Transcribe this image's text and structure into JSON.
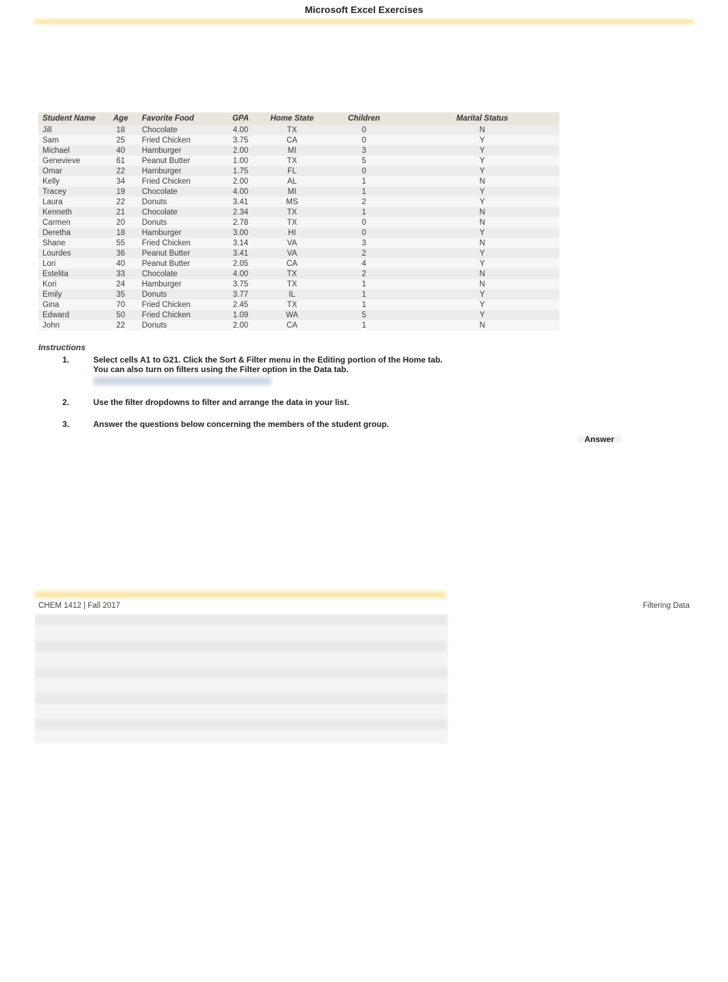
{
  "page_title": "Microsoft Excel Exercises",
  "table": {
    "headers": {
      "name": "Student Name",
      "age": "Age",
      "food": "Favorite Food",
      "gpa": "GPA",
      "state": "Home State",
      "children": "Children",
      "marital": "Marital Status"
    },
    "rows": [
      {
        "name": "Jill",
        "age": "18",
        "food": "Chocolate",
        "gpa": "4.00",
        "state": "TX",
        "children": "0",
        "marital": "N"
      },
      {
        "name": "Sam",
        "age": "25",
        "food": "Fried Chicken",
        "gpa": "3.75",
        "state": "CA",
        "children": "0",
        "marital": "Y"
      },
      {
        "name": "Michael",
        "age": "40",
        "food": "Hamburger",
        "gpa": "2.00",
        "state": "MI",
        "children": "3",
        "marital": "Y"
      },
      {
        "name": "Genevieve",
        "age": "61",
        "food": "Peanut Butter",
        "gpa": "1.00",
        "state": "TX",
        "children": "5",
        "marital": "Y"
      },
      {
        "name": "Omar",
        "age": "22",
        "food": "Hamburger",
        "gpa": "1.75",
        "state": "FL",
        "children": "0",
        "marital": "Y"
      },
      {
        "name": "Kelly",
        "age": "34",
        "food": "Fried Chicken",
        "gpa": "2.00",
        "state": "AL",
        "children": "1",
        "marital": "N"
      },
      {
        "name": "Tracey",
        "age": "19",
        "food": "Chocolate",
        "gpa": "4.00",
        "state": "MI",
        "children": "1",
        "marital": "Y"
      },
      {
        "name": "Laura",
        "age": "22",
        "food": "Donuts",
        "gpa": "3.41",
        "state": "MS",
        "children": "2",
        "marital": "Y"
      },
      {
        "name": "Kenneth",
        "age": "21",
        "food": "Chocolate",
        "gpa": "2.34",
        "state": "TX",
        "children": "1",
        "marital": "N"
      },
      {
        "name": "Carmen",
        "age": "20",
        "food": "Donuts",
        "gpa": "2.78",
        "state": "TX",
        "children": "0",
        "marital": "N"
      },
      {
        "name": "Deretha",
        "age": "18",
        "food": "Hamburger",
        "gpa": "3.00",
        "state": "HI",
        "children": "0",
        "marital": "Y"
      },
      {
        "name": "Shane",
        "age": "55",
        "food": "Fried Chicken",
        "gpa": "3.14",
        "state": "VA",
        "children": "3",
        "marital": "N"
      },
      {
        "name": "Lourdes",
        "age": "36",
        "food": "Peanut Butter",
        "gpa": "3.41",
        "state": "VA",
        "children": "2",
        "marital": "Y"
      },
      {
        "name": "Lori",
        "age": "40",
        "food": "Peanut Butter",
        "gpa": "2.05",
        "state": "CA",
        "children": "4",
        "marital": "Y"
      },
      {
        "name": "Estelita",
        "age": "33",
        "food": "Chocolate",
        "gpa": "4.00",
        "state": "TX",
        "children": "2",
        "marital": "N"
      },
      {
        "name": "Kori",
        "age": "24",
        "food": "Hamburger",
        "gpa": "3.75",
        "state": "TX",
        "children": "1",
        "marital": "N"
      },
      {
        "name": "Emily",
        "age": "35",
        "food": "Donuts",
        "gpa": "3.77",
        "state": "IL",
        "children": "1",
        "marital": "Y"
      },
      {
        "name": "Gina",
        "age": "70",
        "food": "Fried Chicken",
        "gpa": "2.45",
        "state": "TX",
        "children": "1",
        "marital": "Y"
      },
      {
        "name": "Edward",
        "age": "50",
        "food": "Fried Chicken",
        "gpa": "1.09",
        "state": "WA",
        "children": "5",
        "marital": "Y"
      },
      {
        "name": "John",
        "age": "22",
        "food": "Donuts",
        "gpa": "2.00",
        "state": "CA",
        "children": "1",
        "marital": "N"
      }
    ]
  },
  "instructions": {
    "label": "Instructions",
    "items": [
      {
        "num": "1.",
        "text": "Select cells A1 to G21. Click the Sort & Filter menu in the Editing portion of the Home tab.",
        "sub": "You can also turn on filters using the Filter option in the Data tab."
      },
      {
        "num": "2.",
        "text": "Use the filter dropdowns to filter and arrange the data in your list."
      },
      {
        "num": "3.",
        "text": "Answer the questions below concerning the members of the student group."
      }
    ]
  },
  "answer_label": "Answer",
  "footer": {
    "left": "CHEM 1412 | Fall 2017",
    "right": "Filtering Data"
  }
}
